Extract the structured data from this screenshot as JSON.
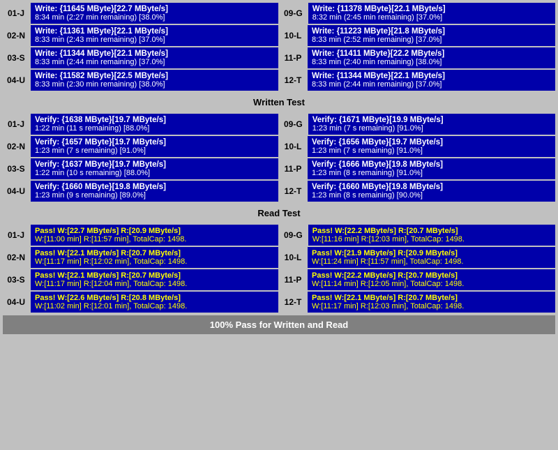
{
  "sections": {
    "write_test": {
      "label": "Written Test",
      "rows": [
        {
          "left_label": "01-J",
          "left_line1": "Write: {11645 MByte}[22.7 MByte/s]",
          "left_line2": "8:34 min (2:27 min remaining)  [38.0%]",
          "right_label": "09-G",
          "right_line1": "Write: {11378 MByte}[22.1 MByte/s]",
          "right_line2": "8:32 min (2:45 min remaining)  [37.0%]"
        },
        {
          "left_label": "02-N",
          "left_line1": "Write: {11361 MByte}[22.1 MByte/s]",
          "left_line2": "8:33 min (2:43 min remaining)  [37.0%]",
          "right_label": "10-L",
          "right_line1": "Write: {11223 MByte}[21.8 MByte/s]",
          "right_line2": "8:33 min (2:52 min remaining)  [37.0%]"
        },
        {
          "left_label": "03-S",
          "left_line1": "Write: {11344 MByte}[22.1 MByte/s]",
          "left_line2": "8:33 min (2:44 min remaining)  [37.0%]",
          "right_label": "11-P",
          "right_line1": "Write: {11411 MByte}[22.2 MByte/s]",
          "right_line2": "8:33 min (2:40 min remaining)  [38.0%]"
        },
        {
          "left_label": "04-U",
          "left_line1": "Write: {11582 MByte}[22.5 MByte/s]",
          "left_line2": "8:33 min (2:30 min remaining)  [38.0%]",
          "right_label": "12-T",
          "right_line1": "Write: {11344 MByte}[22.1 MByte/s]",
          "right_line2": "8:33 min (2:44 min remaining)  [37.0%]"
        }
      ]
    },
    "verify_test": {
      "label": "Written Test",
      "rows": [
        {
          "left_label": "01-J",
          "left_line1": "Verify: {1638 MByte}[19.7 MByte/s]",
          "left_line2": "1:22 min (11 s remaining)   [88.0%]",
          "right_label": "09-G",
          "right_line1": "Verify: {1671 MByte}[19.9 MByte/s]",
          "right_line2": "1:23 min (7 s remaining)   [91.0%]"
        },
        {
          "left_label": "02-N",
          "left_line1": "Verify: {1657 MByte}[19.7 MByte/s]",
          "left_line2": "1:23 min (7 s remaining)   [91.0%]",
          "right_label": "10-L",
          "right_line1": "Verify: {1656 MByte}[19.7 MByte/s]",
          "right_line2": "1:23 min (7 s remaining)   [91.0%]"
        },
        {
          "left_label": "03-S",
          "left_line1": "Verify: {1637 MByte}[19.7 MByte/s]",
          "left_line2": "1:22 min (10 s remaining)   [88.0%]",
          "right_label": "11-P",
          "right_line1": "Verify: {1666 MByte}[19.8 MByte/s]",
          "right_line2": "1:23 min (8 s remaining)   [91.0%]"
        },
        {
          "left_label": "04-U",
          "left_line1": "Verify: {1660 MByte}[19.8 MByte/s]",
          "left_line2": "1:23 min (9 s remaining)   [89.0%]",
          "right_label": "12-T",
          "right_line1": "Verify: {1660 MByte}[19.8 MByte/s]",
          "right_line2": "1:23 min (8 s remaining)   [90.0%]"
        }
      ]
    },
    "read_test": {
      "label": "Read Test",
      "rows": [
        {
          "left_label": "01-J",
          "left_line1": "Pass! W:[22.7 MByte/s] R:[20.9 MByte/s]",
          "left_line2": "W:[11:00 min] R:[11:57 min], TotalCap: 1498.",
          "right_label": "09-G",
          "right_line1": "Pass! W:[22.2 MByte/s] R:[20.7 MByte/s]",
          "right_line2": "W:[11:16 min] R:[12:03 min], TotalCap: 1498."
        },
        {
          "left_label": "02-N",
          "left_line1": "Pass! W:[22.1 MByte/s] R:[20.7 MByte/s]",
          "left_line2": "W:[11:17 min] R:[12:02 min], TotalCap: 1498.",
          "right_label": "10-L",
          "right_line1": "Pass! W:[21.9 MByte/s] R:[20.9 MByte/s]",
          "right_line2": "W:[11:24 min] R:[11:57 min], TotalCap: 1498."
        },
        {
          "left_label": "03-S",
          "left_line1": "Pass! W:[22.1 MByte/s] R:[20.7 MByte/s]",
          "left_line2": "W:[11:17 min] R:[12:04 min], TotalCap: 1498.",
          "right_label": "11-P",
          "right_line1": "Pass! W:[22.2 MByte/s] R:[20.7 MByte/s]",
          "right_line2": "W:[11:14 min] R:[12:05 min], TotalCap: 1498."
        },
        {
          "left_label": "04-U",
          "left_line1": "Pass! W:[22.6 MByte/s] R:[20.8 MByte/s]",
          "left_line2": "W:[11:02 min] R:[12:01 min], TotalCap: 1498.",
          "right_label": "12-T",
          "right_line1": "Pass! W:[22.1 MByte/s] R:[20.7 MByte/s]",
          "right_line2": "W:[11:17 min] R:[12:03 min], TotalCap: 1498."
        }
      ]
    }
  },
  "footer": "100% Pass for Written and Read",
  "section_headers": {
    "written": "Written Test",
    "read": "Read Test"
  }
}
